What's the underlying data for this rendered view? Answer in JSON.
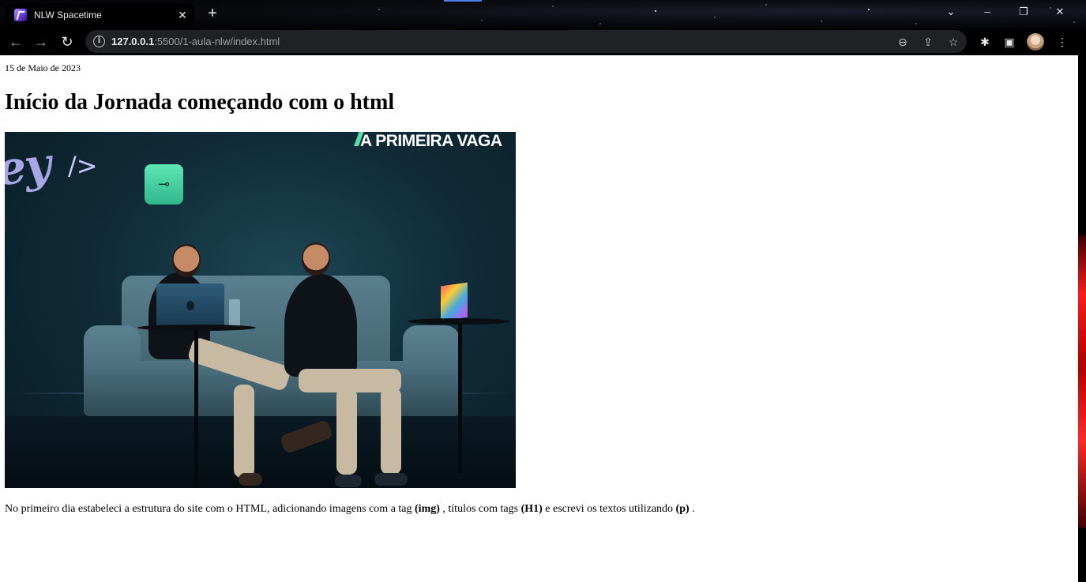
{
  "browser": {
    "tab": {
      "title": "NLW Spacetime",
      "close_glyph": "✕"
    },
    "new_tab_glyph": "+",
    "window_controls": {
      "collapse": "⌄",
      "minimize": "–",
      "restore": "❐",
      "close": "✕"
    },
    "nav": {
      "back": "←",
      "forward": "→",
      "reload": "↻"
    },
    "address": {
      "host": "127.0.0.1",
      "rest": ":5500/1-aula-nlw/index.html",
      "info_glyph": "i"
    },
    "omnibox_icons": {
      "zoom": "⊖",
      "share": "⇪",
      "bookmark": "☆"
    },
    "toolbar_icons": {
      "extensions": "✱",
      "sidepanel": "▣",
      "menu": "⋮"
    }
  },
  "page": {
    "date": "15 de Maio de 2023",
    "title": "Início da Jornada começando com o html",
    "hero_image": {
      "script_text": "ey",
      "script_tag": "/>",
      "banner_text": "A PRIMEIRA VAGA",
      "key_symbol": "⊸"
    },
    "paragraph": {
      "part1": "No primeiro dia estabeleci a estrutura do site com o HTML, adicionando imagens com a tag ",
      "img_tag": "(img)",
      "part2": " , títulos com tags ",
      "h1_tag": "(H1)",
      "part3": " e escrevi os textos utilizando ",
      "p_tag": "(p)",
      "part4": " ."
    }
  },
  "colors": {
    "accent_blue": "#4f7fe8",
    "key_tile_green": "#52e0a4",
    "script_lilac": "#a9a6e8",
    "side_deco_red": "#ff1a1a"
  }
}
